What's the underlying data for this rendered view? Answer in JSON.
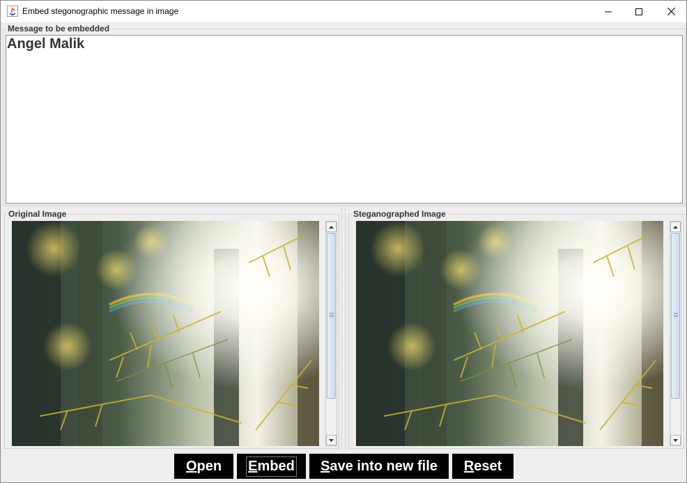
{
  "window": {
    "title": "Embed stegonographic message in image",
    "controls": [
      "minimize-icon",
      "maximize-icon",
      "close-icon"
    ]
  },
  "message_panel": {
    "title": "Message to be embedded",
    "text": "Angel Malik"
  },
  "original_panel": {
    "title": "Original Image",
    "image": "sunlit forest with conifer branches and lens flare"
  },
  "stego_panel": {
    "title": "Steganographed Image",
    "image": "sunlit forest with conifer branches and lens flare"
  },
  "buttons": {
    "open": {
      "mnemonic": "O",
      "rest": "pen"
    },
    "embed": {
      "mnemonic": "E",
      "rest": "mbed"
    },
    "save": {
      "mnemonic": "S",
      "rest": "ave into new file"
    },
    "reset": {
      "mnemonic": "R",
      "rest": "eset"
    }
  }
}
